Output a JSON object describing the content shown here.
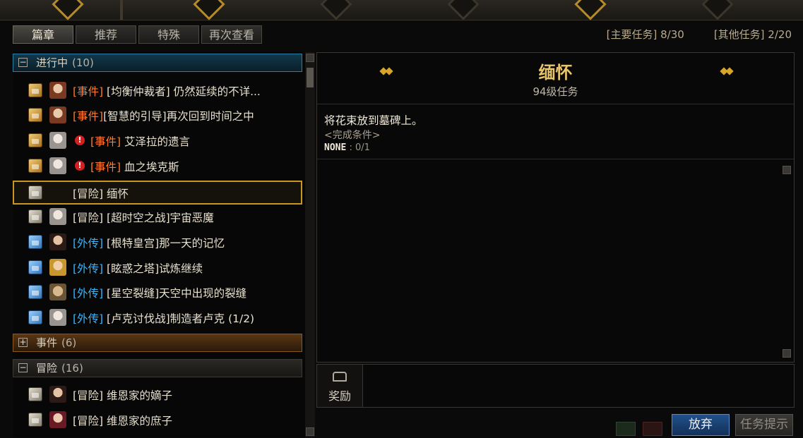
{
  "tabs": [
    "篇章",
    "推荐",
    "特殊",
    "再次查看"
  ],
  "counters": {
    "main": "[主要任务] 8/30",
    "other": "[其他任务] 2/20"
  },
  "groups": {
    "in_progress": {
      "name": "进行中",
      "count": "(10)",
      "toggle": "−"
    },
    "events": {
      "name": "事件",
      "count": "(6)",
      "toggle": "+"
    },
    "adventure": {
      "name": "冒险",
      "count": "(16)",
      "toggle": "−"
    }
  },
  "in_progress_items": [
    {
      "tag": "[事件]",
      "title": "[均衡仲裁者] 仍然延续的不详..."
    },
    {
      "tag": "[事件]",
      "title": "[智慧的引导]再次回到时间之中"
    },
    {
      "tag": "[事件]",
      "title": "艾泽拉的遗言"
    },
    {
      "tag": "[事件]",
      "title": "血之埃克斯"
    },
    {
      "tag": "[冒险]",
      "title": "缅怀"
    },
    {
      "tag": "[冒险]",
      "title": "[超时空之战]宇宙恶魔"
    },
    {
      "tag": "[外传]",
      "title": "[根特皇宫]那一天的记忆"
    },
    {
      "tag": "[外传]",
      "title": "[眩惑之塔]试炼继续"
    },
    {
      "tag": "[外传]",
      "title": "[星空裂缝]天空中出现的裂缝"
    },
    {
      "tag": "[外传]",
      "title": "[卢克讨伐战]制造者卢克 (1/2)"
    }
  ],
  "adventure_items": [
    {
      "tag": "[冒险]",
      "title": "维恩家的嫡子"
    },
    {
      "tag": "[冒险]",
      "title": "维恩家的庶子"
    }
  ],
  "alert_glyph": "!",
  "detail": {
    "name": "缅怀",
    "level": "94级任务",
    "description": "将花束放到墓碑上。",
    "condition_title": "<完成条件>",
    "condition_key": "NONE",
    "condition_value": " : 0/1"
  },
  "reward": {
    "label": "奖励"
  },
  "buttons": {
    "abandon": "放弃",
    "hint": "任务提示"
  },
  "colors": {
    "event_tag": "#ff7a2a",
    "side_tag": "#36b6ff",
    "selected_border": "#c9961f",
    "quest_name": "#e8c56a"
  }
}
